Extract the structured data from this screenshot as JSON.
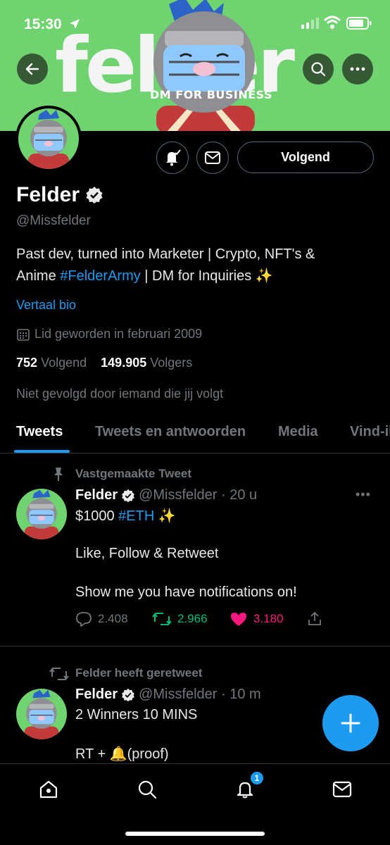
{
  "status_bar": {
    "time": "15:30"
  },
  "banner": {
    "word": "felder",
    "subtitle": "DM FOR BUSINESS"
  },
  "profile": {
    "name": "Felder",
    "handle": "@Missfelder",
    "bio_part1": "Past dev, turned into Marketer | Crypto, NFT's &",
    "bio_part2": "Anime ",
    "bio_hashtag": "#FelderArmy",
    "bio_part3": " | DM for Inquiries ✨",
    "translate_label": "Vertaal bio",
    "joined": "Lid geworden in februari 2009",
    "following_count": "752",
    "following_label": "Volgend",
    "followers_count": "149.905",
    "followers_label": "Volgers",
    "not_followed_text": "Niet gevolgd door iemand die jij volgt",
    "follow_button_label": "Volgend"
  },
  "tabs": [
    "Tweets",
    "Tweets en antwoorden",
    "Media",
    "Vind-ik-leuks"
  ],
  "active_tab": "Tweets",
  "tweets": [
    {
      "context": "Vastgemaakte Tweet",
      "name": "Felder",
      "meta": "@Missfelder · 20 u",
      "line1_prefix": "$1000 ",
      "line1_hashtag": "#ETH",
      "line1_suffix": " ✨",
      "line2": "Like, Follow & Retweet",
      "line3": "Show me you have notifications on!",
      "replies": "2.408",
      "retweets": "2.966",
      "likes": "3.180"
    },
    {
      "context": "Felder heeft geretweet",
      "name": "Felder",
      "meta": "@Missfelder · 10 m",
      "line1": "2 Winners 10 MINS",
      "line2": "RT + 🔔(proof)"
    }
  ],
  "bottom_nav": {
    "notifications_badge": "1"
  },
  "colors": {
    "accent": "#1d9bf0",
    "retweet": "#00ba7c",
    "like": "#f91880",
    "banner": "#6fd36f",
    "muted": "#71767b"
  }
}
